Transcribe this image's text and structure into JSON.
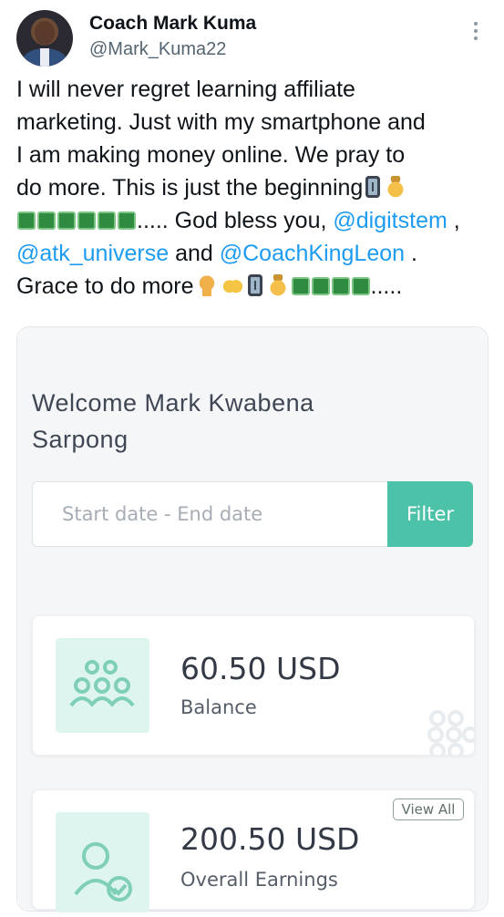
{
  "tweet": {
    "author_name": "Coach Mark Kuma",
    "author_handle": "@Mark_Kuma22",
    "line1": "I will never regret learning affiliate",
    "line2": "marketing. Just with my smartphone and",
    "line3": "I am making money online. We pray to",
    "line4_text": "do more. This is just the beginning",
    "line5_text": "..... God bless you, ",
    "line5_mention": "@digitstem",
    "line5_end": " ,",
    "line6_mention1": "@atk_universe",
    "line6_mid": " and ",
    "line6_mention2": "@CoachKingLeon",
    "line6_end": " .",
    "line7_text": "Grace to do more",
    "line7_end": ".....",
    "emojis": [
      "mobile-phone",
      "money-bag",
      "dollar-banknote",
      "person-bowing",
      "raising-hands"
    ]
  },
  "dashboard": {
    "welcome_line1": "Welcome Mark Kwabena",
    "welcome_line2": "Sarpong",
    "date_placeholder": "Start date - End date",
    "filter_label": "Filter",
    "balance": {
      "value": "60.50 USD",
      "label": "Balance",
      "icon": "users-icon"
    },
    "overall": {
      "value": "200.50 USD",
      "label": "Overall Earnings",
      "view_all": "View All",
      "icon": "user-check-icon"
    }
  },
  "colors": {
    "accent": "#4cc2a8",
    "mention": "#1d9bf0",
    "icon_bg": "#def5ef"
  }
}
